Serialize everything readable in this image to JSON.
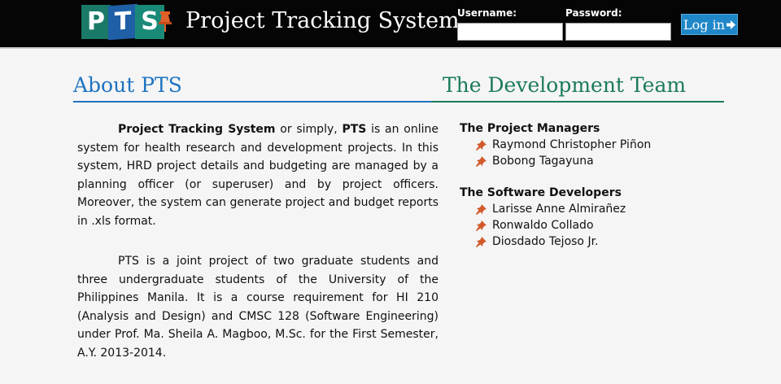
{
  "header": {
    "logo_letters": [
      "P",
      "T",
      "S"
    ],
    "app_title": "Project Tracking System",
    "username_label": "Username:",
    "password_label": "Password:",
    "username_value": "",
    "password_value": "",
    "login_label": "Log in",
    "colors": {
      "bar": "#050505",
      "logo_green": "#1a7a67",
      "logo_blue": "#1f5fa6",
      "pin": "#e0602a",
      "button": "#1f87c8"
    }
  },
  "about": {
    "title": "About PTS",
    "p1_strong1": "Project Tracking System",
    "p1_text1": " or simply, ",
    "p1_strong2": "PTS",
    "p1_text2": " is an online system for health research and development projects. In this system, HRD project details and budgeting are managed by a planning officer (or superuser) and by project officers. Moreover, the system can generate project and budget reports in .xls format.",
    "p2": "PTS is a joint project of two graduate students and three undergraduate students of the University of the Philippines Manila. It is a course requirement for HI 210 (Analysis and Design) and CMSC 128 (Software Engineering) under Prof. Ma. Sheila A. Magboo, M.Sc. for the First Semester, A.Y. 2013-2014."
  },
  "team": {
    "title": "The Development Team",
    "groups": [
      {
        "title": "The Project Managers",
        "members": [
          "Raymond Christopher Piñon",
          "Bobong Tagayuna"
        ]
      },
      {
        "title": "The Software Developers",
        "members": [
          "Larisse Anne Almirañez",
          "Ronwaldo Collado",
          "Diosdado Tejoso Jr."
        ]
      }
    ],
    "bullet_icon": "pushpin-icon",
    "colors": {
      "title": "#1b7a5c",
      "about_title": "#1f74c1"
    }
  }
}
